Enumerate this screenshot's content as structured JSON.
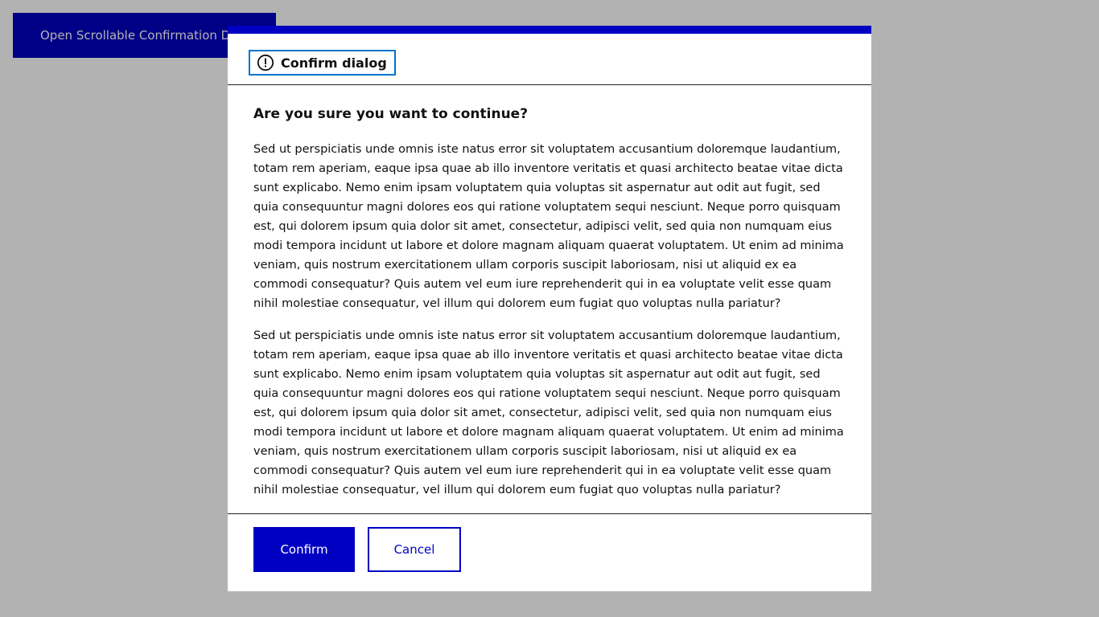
{
  "page": {
    "open_dialog_button_label": "Open Scrollable Confirmation Dialog"
  },
  "dialog": {
    "title": "Confirm dialog",
    "title_icon": "alert-circle-icon",
    "question": "Are you sure you want to continue?",
    "paragraphs": [
      "Sed ut perspiciatis unde omnis iste natus error sit voluptatem accusantium doloremque laudantium, totam rem aperiam, eaque ipsa quae ab illo inventore veritatis et quasi architecto beatae vitae dicta sunt explicabo. Nemo enim ipsam voluptatem quia voluptas sit aspernatur aut odit aut fugit, sed quia consequuntur magni dolores eos qui ratione voluptatem sequi nesciunt. Neque porro quisquam est, qui dolorem ipsum quia dolor sit amet, consectetur, adipisci velit, sed quia non numquam eius modi tempora incidunt ut labore et dolore magnam aliquam quaerat voluptatem. Ut enim ad minima veniam, quis nostrum exercitationem ullam corporis suscipit laboriosam, nisi ut aliquid ex ea commodi consequatur? Quis autem vel eum iure reprehenderit qui in ea voluptate velit esse quam nihil molestiae consequatur, vel illum qui dolorem eum fugiat quo voluptas nulla pariatur?",
      "Sed ut perspiciatis unde omnis iste natus error sit voluptatem accusantium doloremque laudantium, totam rem aperiam, eaque ipsa quae ab illo inventore veritatis et quasi architecto beatae vitae dicta sunt explicabo. Nemo enim ipsam voluptatem quia voluptas sit aspernatur aut odit aut fugit, sed quia consequuntur magni dolores eos qui ratione voluptatem sequi nesciunt. Neque porro quisquam est, qui dolorem ipsum quia dolor sit amet, consectetur, adipisci velit, sed quia non numquam eius modi tempora incidunt ut labore et dolore magnam aliquam quaerat voluptatem. Ut enim ad minima veniam, quis nostrum exercitationem ullam corporis suscipit laboriosam, nisi ut aliquid ex ea commodi consequatur? Quis autem vel eum iure reprehenderit qui in ea voluptate velit esse quam nihil molestiae consequatur, vel illum qui dolorem eum fugiat quo voluptas nulla pariatur?"
    ],
    "confirm_label": "Confirm",
    "cancel_label": "Cancel"
  },
  "colors": {
    "primary": "#0000c2",
    "focus_outline": "#0073cf",
    "overlay": "rgba(0,0,0,0.30)",
    "text": "#111111"
  }
}
